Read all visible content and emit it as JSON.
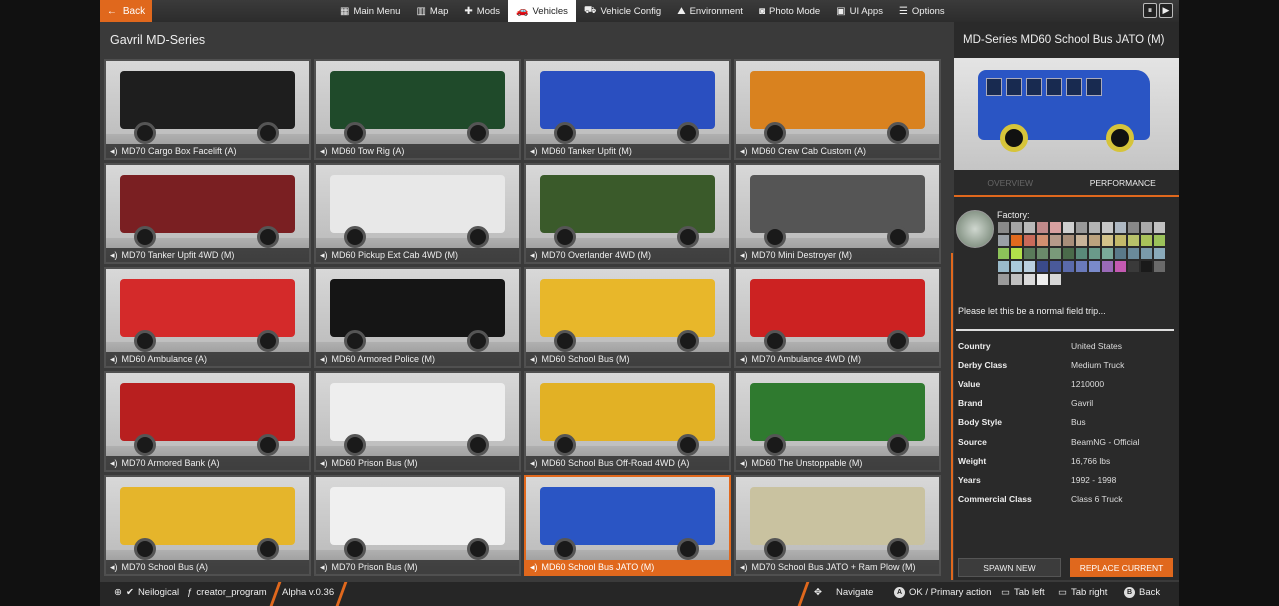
{
  "topbar": {
    "back": "Back",
    "nav": [
      {
        "icon": "home-icon",
        "glyph": "▦",
        "label": "Main Menu",
        "active": false
      },
      {
        "icon": "map-icon",
        "glyph": "▥",
        "label": "Map",
        "active": false
      },
      {
        "icon": "mods-icon",
        "glyph": "✚",
        "label": "Mods",
        "active": false
      },
      {
        "icon": "car-icon",
        "glyph": "🚗",
        "label": "Vehicles",
        "active": true
      },
      {
        "icon": "vehicle-config-icon",
        "glyph": "⛟",
        "label": "Vehicle Config",
        "active": false
      },
      {
        "icon": "environment-icon",
        "glyph": "⛰",
        "label": "Environment",
        "active": false
      },
      {
        "icon": "camera-icon",
        "glyph": "◙",
        "label": "Photo Mode",
        "active": false
      },
      {
        "icon": "ui-apps-icon",
        "glyph": "▣",
        "label": "UI Apps",
        "active": false
      },
      {
        "icon": "options-icon",
        "glyph": "☰",
        "label": "Options",
        "active": false
      }
    ]
  },
  "list": {
    "title": "Gavril MD-Series",
    "tiles": [
      {
        "label": "MD70 Cargo Box Facelift (A)",
        "color": "#1e1e1e"
      },
      {
        "label": "MD60 Tow Rig (A)",
        "color": "#1f4a2a"
      },
      {
        "label": "MD60 Tanker Upfit (M)",
        "color": "#2a4fc0"
      },
      {
        "label": "MD60 Crew Cab Custom (A)",
        "color": "#d9821f"
      },
      {
        "label": "MD70 Tanker Upfit 4WD (M)",
        "color": "#7a1f22"
      },
      {
        "label": "MD60 Pickup Ext Cab 4WD (M)",
        "color": "#e8e8e8"
      },
      {
        "label": "MD70 Overlander 4WD (M)",
        "color": "#3a5a2a"
      },
      {
        "label": "MD70 Mini Destroyer (M)",
        "color": "#555555"
      },
      {
        "label": "MD60 Ambulance (A)",
        "color": "#d42a2a"
      },
      {
        "label": "MD60 Armored Police (M)",
        "color": "#151515"
      },
      {
        "label": "MD60 School Bus (M)",
        "color": "#e8b72a"
      },
      {
        "label": "MD70 Ambulance 4WD (M)",
        "color": "#cc2222"
      },
      {
        "label": "MD70 Armored Bank (A)",
        "color": "#b81f1f"
      },
      {
        "label": "MD60 Prison Bus (M)",
        "color": "#eeeeee"
      },
      {
        "label": "MD60 School Bus Off-Road 4WD (A)",
        "color": "#e2b125"
      },
      {
        "label": "MD60 The Unstoppable (M)",
        "color": "#2f7a2f"
      },
      {
        "label": "MD70 School Bus (A)",
        "color": "#e5b52b"
      },
      {
        "label": "MD70 Prison Bus (M)",
        "color": "#f0f0f0"
      },
      {
        "label": "MD60 School Bus JATO (M)",
        "color": "#2a55c4",
        "selected": true
      },
      {
        "label": "MD70 School Bus JATO + Ram Plow (M)",
        "color": "#c9c2a0"
      }
    ]
  },
  "details": {
    "title": "MD-Series MD60 School Bus JATO (M)",
    "tab_overview": "OVERVIEW",
    "tab_performance": "PERFORMANCE",
    "factory_label": "Factory:",
    "description": "Please let this be a normal field trip...",
    "info": [
      {
        "k": "Country",
        "v": "United States"
      },
      {
        "k": "Derby Class",
        "v": "Medium Truck"
      },
      {
        "k": "Value",
        "v": "1210000"
      },
      {
        "k": "Brand",
        "v": "Gavril"
      },
      {
        "k": "Body Style",
        "v": "Bus"
      },
      {
        "k": "Source",
        "v": "BeamNG - Official"
      },
      {
        "k": "Weight",
        "v": "16,766 lbs"
      },
      {
        "k": "Years",
        "v": "1992 - 1998"
      },
      {
        "k": "Commercial Class",
        "v": "Class 6 Truck"
      }
    ],
    "spawn_new": "SPAWN NEW",
    "replace_current": "REPLACE CURRENT",
    "swatches": [
      "#8a8a8a",
      "#a5a5a5",
      "#b9b9b9",
      "#c08a8a",
      "#d9a0a0",
      "#cfcfcf",
      "#9a9a9a",
      "#b4b4b4",
      "#c7c7c7",
      "#aeb8c2",
      "#888",
      "#a9a9a9",
      "#c1c1c1",
      "#9aa0a6",
      "#e06a1e",
      "#c96a5a",
      "#d18f70",
      "#b69a8a",
      "#a88e7a",
      "#c8b49a",
      "#bca27e",
      "#d2c28a",
      "#c3b96a",
      "#b8c26a",
      "#a9c25a",
      "#9bc25a",
      "#8cc25a",
      "#b2e04a",
      "#5a7a5a",
      "#6a8a6a",
      "#7a9a7a",
      "#4a6a4a",
      "#5a8a7a",
      "#6a9a8a",
      "#7aaa9a",
      "#5a7a8a",
      "#6a8a9a",
      "#7a9aaa",
      "#8aaaba",
      "#9abaca",
      "#aacada",
      "#bad0e0",
      "#3a4a8a",
      "#4a5a9a",
      "#5a6aaa",
      "#6a7aba",
      "#7a8aca",
      "#9a6ab8",
      "#c45ab2",
      "#3a3a3a",
      "#1a1a1a",
      "#6a6a6a",
      "#9a9a9a",
      "#c0c0c0",
      "#dadada",
      "#eeeeee",
      "#d6d6d6"
    ]
  },
  "bottombar": {
    "user": "Neilogical",
    "program": "creator_program",
    "version": "Alpha v.0.36",
    "navigate": "Navigate",
    "ok": "OK / Primary action",
    "tab_left": "Tab left",
    "tab_right": "Tab right",
    "back": "Back"
  }
}
